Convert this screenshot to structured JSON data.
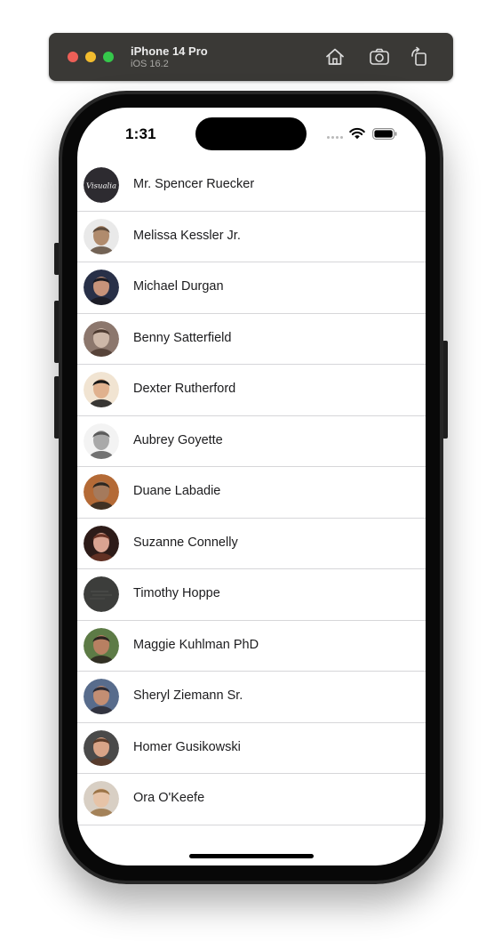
{
  "simulator": {
    "device_name": "iPhone 14 Pro",
    "os_version": "iOS 16.2",
    "buttons": [
      {
        "icon": "home-icon"
      },
      {
        "icon": "screenshot-icon"
      },
      {
        "icon": "rotate-icon"
      }
    ]
  },
  "status_bar": {
    "time": "1:31",
    "icons": [
      "cellular-icon",
      "wifi-icon",
      "battery-icon"
    ]
  },
  "contacts": [
    {
      "name": "Mr. Spencer Ruecker",
      "avatar": {
        "bg": "#2d2b30",
        "skin": "#2d2b30",
        "hair": "#2d2b30",
        "kind": "logo",
        "logo_text": "Visualia"
      }
    },
    {
      "name": "Melissa Kessler Jr.",
      "avatar": {
        "bg": "#e9e9e9",
        "skin": "#b08b6d",
        "hair": "#5e4b3b",
        "kind": "face"
      }
    },
    {
      "name": "Michael Durgan",
      "avatar": {
        "bg": "#283048",
        "skin": "#c7937a",
        "hair": "#1a1a22",
        "kind": "face"
      }
    },
    {
      "name": "Benny Satterfield",
      "avatar": {
        "bg": "#8c776d",
        "skin": "#cdb7a8",
        "hair": "#4d3a30",
        "kind": "face"
      }
    },
    {
      "name": "Dexter Rutherford",
      "avatar": {
        "bg": "#f1e4d2",
        "skin": "#e0b18e",
        "hair": "#171717",
        "kind": "face"
      }
    },
    {
      "name": "Aubrey Goyette",
      "avatar": {
        "bg": "#f3f3f3",
        "skin": "#a9a9a9",
        "hair": "#5a5a5a",
        "kind": "face"
      }
    },
    {
      "name": "Duane Labadie",
      "avatar": {
        "bg": "#b46a36",
        "skin": "#a57a5c",
        "hair": "#2d2720",
        "kind": "face"
      }
    },
    {
      "name": "Suzanne Connelly",
      "avatar": {
        "bg": "#2d1b18",
        "skin": "#d9a391",
        "hair": "#6b3426",
        "kind": "face"
      }
    },
    {
      "name": "Timothy Hoppe",
      "avatar": {
        "bg": "#3c3d3b",
        "skin": "#3c3d3b",
        "hair": "#3c3d3b",
        "kind": "texture"
      }
    },
    {
      "name": "Maggie Kuhlman PhD",
      "avatar": {
        "bg": "#5d7b46",
        "skin": "#b88062",
        "hair": "#2a231f",
        "kind": "face"
      }
    },
    {
      "name": "Sheryl Ziemann Sr.",
      "avatar": {
        "bg": "#586c8c",
        "skin": "#c38e73",
        "hair": "#2b2a33",
        "kind": "face"
      }
    },
    {
      "name": "Homer Gusikowski",
      "avatar": {
        "bg": "#4a4a4a",
        "skin": "#d9a487",
        "hair": "#5a3a28",
        "kind": "face"
      }
    },
    {
      "name": "Ora O'Keefe",
      "avatar": {
        "bg": "#d8cfc4",
        "skin": "#e6c3a7",
        "hair": "#9b7447",
        "kind": "face"
      }
    }
  ],
  "colors": {
    "separator": "#d6d6d9",
    "toolbar": "#3a3936",
    "text": "#1c1c1e"
  }
}
